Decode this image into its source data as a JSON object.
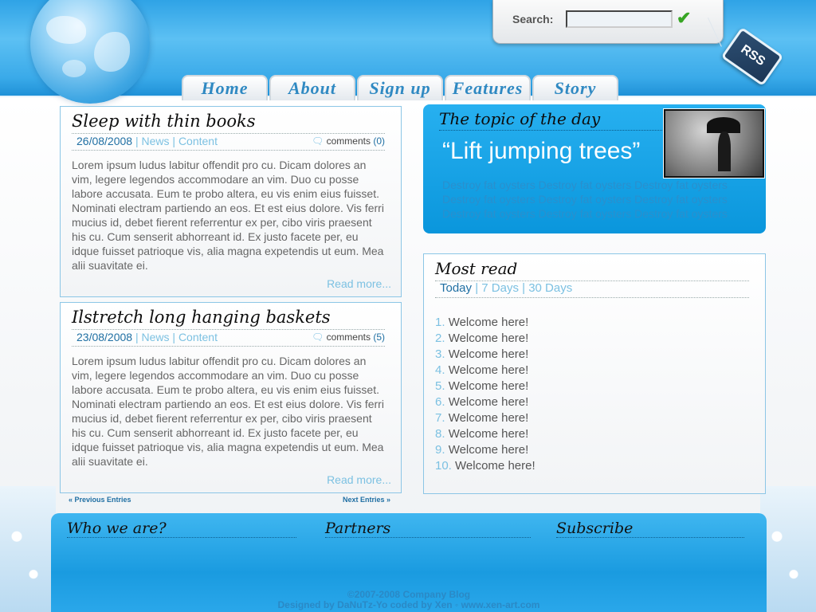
{
  "header": {
    "search_label": "Search:",
    "search_value": "",
    "search_go_icon": "checkmark-icon",
    "rss_label": "RSS"
  },
  "nav": [
    {
      "label": "Home"
    },
    {
      "label": "About"
    },
    {
      "label": "Sign up"
    },
    {
      "label": "Features"
    },
    {
      "label": "Story"
    }
  ],
  "posts": [
    {
      "title": "Sleep with thin books",
      "date": "26/08/2008",
      "sep1": " | ",
      "cat1": "News",
      "sep2": " | ",
      "cat2": "Content",
      "comments_label": "comments",
      "comments_count": "(0)",
      "body": "Lorem ipsum ludus labitur offendit pro cu. Dicam dolores an vim, legere legendos accommodare an vim. Duo cu posse labore accusata. Eum te probo altera, eu vis enim eius fuisset. Nominati electram partiendo an eos. Et est eius dolore. Vis ferri mucius id, debet fierent referrentur ex per, cibo viris praesent his cu. Cum senserit abhorreant id. Ex justo facete per, eu idque fuisset patrioque vis, alia magna expetendis ut eum. Mea alii suavitate ei.",
      "read_more": "Read more..."
    },
    {
      "title": "Ilstretch long hanging baskets",
      "date": "23/08/2008",
      "sep1": " | ",
      "cat1": "News",
      "sep2": " | ",
      "cat2": "Content",
      "comments_label": "comments",
      "comments_count": "(5)",
      "body": "Lorem ipsum ludus labitur offendit pro cu. Dicam dolores an vim, legere legendos accommodare an vim. Duo cu posse labore accusata. Eum te probo altera, eu vis enim eius fuisset. Nominati electram partiendo an eos. Et est eius dolore. Vis ferri mucius id, debet fierent referrentur ex per, cibo viris praesent his cu. Cum senserit abhorreant id. Ex justo facete per, eu idque fuisset patrioque vis, alia magna expetendis ut eum. Mea alii suavitate ei.",
      "read_more": "Read more..."
    }
  ],
  "pager": {
    "prev": "« Previous Entries",
    "next": "Next Entries »"
  },
  "topic": {
    "title": "The topic of the day",
    "quote": "“Lift jumping trees”",
    "text": "Destroy fat oysters Destroy fat oysters Destroy fat oysters Destroy fat oysters Destroy fat oysters Destroy fat oysters Destroy fat oysters Destroy fat oysters Destroy fat oysters"
  },
  "most_read": {
    "title": "Most read",
    "tab_today": "Today",
    "sep1": " | ",
    "tab_7": "7 Days",
    "sep2": " | ",
    "tab_30": "30 Days",
    "items": [
      {
        "num": "1.",
        "label": "Welcome here!"
      },
      {
        "num": "2.",
        "label": "Welcome here!"
      },
      {
        "num": "3.",
        "label": "Welcome here!"
      },
      {
        "num": "4.",
        "label": "Welcome here!"
      },
      {
        "num": "5.",
        "label": "Welcome here!"
      },
      {
        "num": "6.",
        "label": "Welcome here!"
      },
      {
        "num": "7.",
        "label": "Welcome here!"
      },
      {
        "num": "8.",
        "label": "Welcome here!"
      },
      {
        "num": "9.",
        "label": "Welcome here!"
      },
      {
        "num": "10.",
        "label": "Welcome here!"
      }
    ]
  },
  "footer": {
    "who": "Who we are?",
    "partners": "Partners",
    "subscribe": "Subscribe",
    "copyright": "©2007-2008 Company Blog",
    "credits": "Designed by DaNuTz-Yo coded by Xen ◦ www.xen-art.com"
  },
  "colors": {
    "accent": "#1f6fa3",
    "link": "#7cc1e2",
    "sky": "#2fa3e6",
    "nav_text": "#2f89c2"
  }
}
